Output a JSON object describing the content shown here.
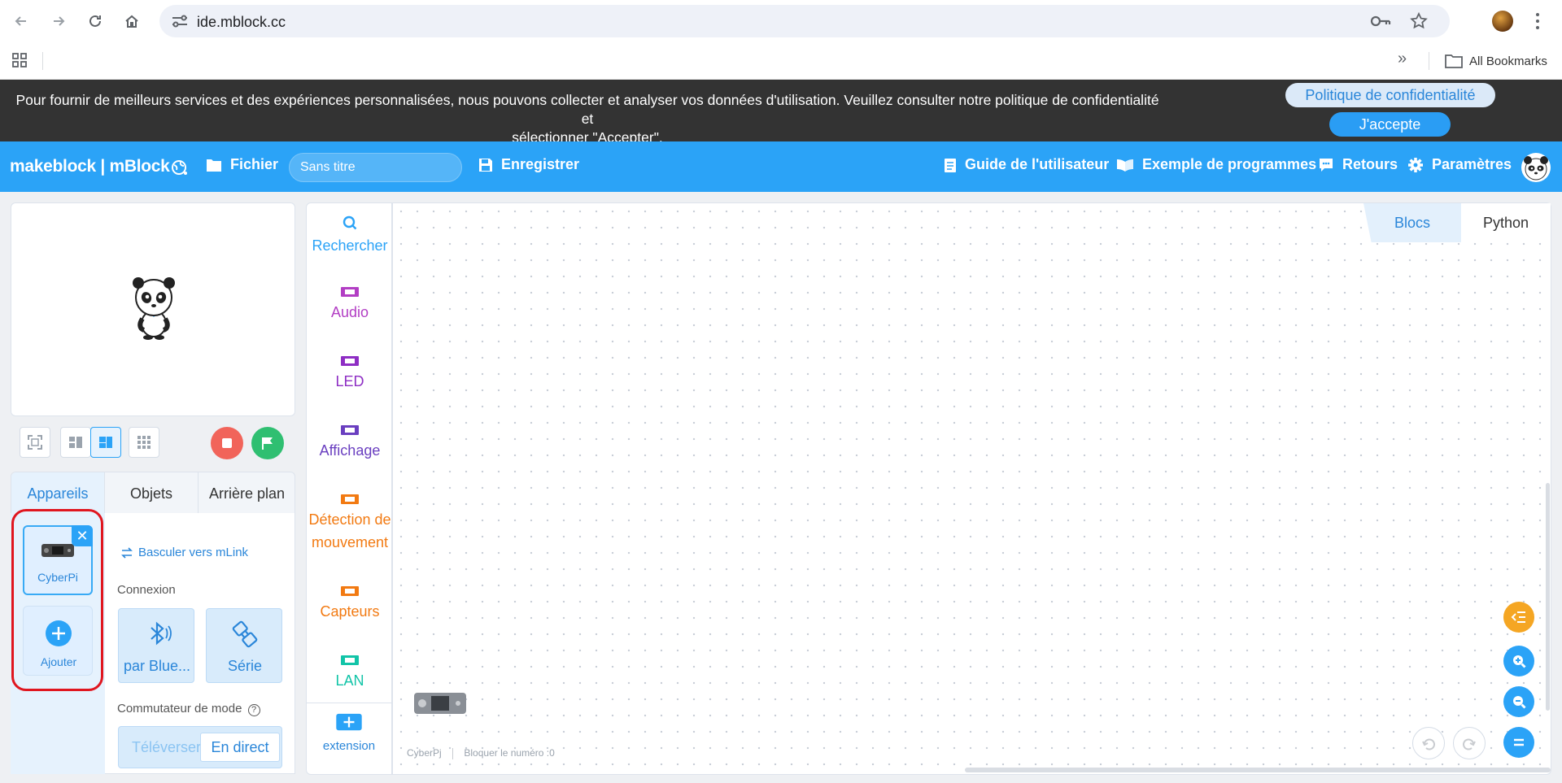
{
  "browser": {
    "url": "ide.mblock.cc",
    "bookmarks_label": "All Bookmarks"
  },
  "cookie_banner": {
    "text_line1": "Pour fournir de meilleurs services et des expériences personnalisées, nous pouvons collecter et analyser vos données d'utilisation. Veuillez consulter notre politique de confidentialité et",
    "text_line2": "sélectionner \"Accepter\".",
    "policy_button": "Politique de confidentialité",
    "accept_button": "J'accepte"
  },
  "topbar": {
    "brand": "makeblock | mBlock",
    "file_menu": "Fichier",
    "project_title": "Sans titre",
    "save": "Enregistrer",
    "user_guide": "Guide de l'utilisateur",
    "examples": "Exemple de programmes",
    "feedback": "Retours",
    "settings": "Paramètres"
  },
  "sprite_tabs": [
    "Appareils",
    "Objets",
    "Arrière plan"
  ],
  "devices": {
    "device_name": "CyberPi",
    "add_label": "Ajouter",
    "switch_mlink": "Basculer vers mLink",
    "connection_label": "Connexion",
    "bluetooth_label": "par Blue...",
    "serial_label": "Série",
    "mode_switch_label": "Commutateur de mode",
    "mode_upload": "Téléverser",
    "mode_live": "En direct"
  },
  "categories": [
    {
      "label": "Rechercher",
      "color": "#2ba3f7"
    },
    {
      "label": "Audio",
      "color": "#b23ec4"
    },
    {
      "label": "LED",
      "color": "#8e2ec4"
    },
    {
      "label": "Affichage",
      "color": "#6a3fc0"
    },
    {
      "label": "Détection de mouvement",
      "color": "#f27a12"
    },
    {
      "label": "Capteurs",
      "color": "#f27a12"
    },
    {
      "label": "LAN",
      "color": "#12c4a8"
    },
    {
      "label": "extension",
      "color": "#2a86d9"
    }
  ],
  "editor": {
    "tab_blocks": "Blocs",
    "tab_python": "Python",
    "status_device": "CyberPj",
    "status_blocks": "Bloquer le numéro :0"
  },
  "colors": {
    "brand_blue": "#2ba3f7",
    "stop_red": "#f1645a",
    "go_green": "#2fbf71",
    "highlight_red": "#e0161f",
    "orange": "#f5a623"
  }
}
